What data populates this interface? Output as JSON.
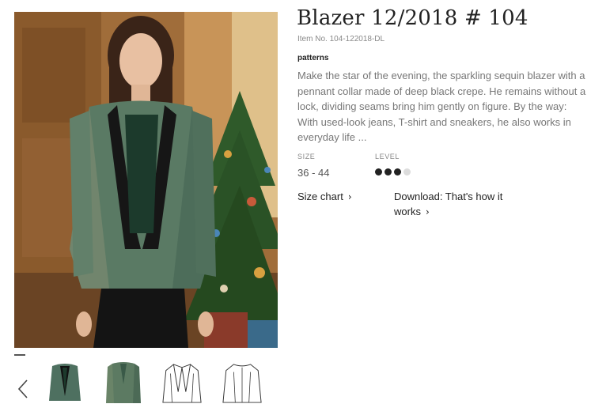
{
  "product": {
    "title": "Blazer 12/2018 # 104",
    "item_no": "Item No. 104-122018-DL",
    "category": "patterns",
    "description": "Make the star of the evening, the sparkling sequin blazer with a pennant collar made of deep black crepe. He remains without a lock, dividing seams bring him gently on figure. By the way: With used-look jeans, T-shirt and sneakers, he also works in everyday life ..."
  },
  "specs": {
    "size_label": "SIZE",
    "size_value": "36 - 44",
    "level_label": "LEVEL",
    "level_value": 3,
    "level_max": 4
  },
  "links": {
    "size_chart": "Size chart",
    "size_chart_icon": "chevron-right-icon",
    "download": "Download: That's how it works",
    "download_icon": "chevron-right-icon"
  },
  "gallery": {
    "prev_icon": "chevron-left-icon",
    "thumbnails": [
      {
        "name": "thumb-model-photo"
      },
      {
        "name": "thumb-blazer-photo"
      },
      {
        "name": "thumb-front-sketch"
      },
      {
        "name": "thumb-back-sketch"
      }
    ]
  },
  "colors": {
    "title": "#222222",
    "description": "#777777",
    "level_on": "#222222",
    "level_off": "#dcdcdc"
  }
}
